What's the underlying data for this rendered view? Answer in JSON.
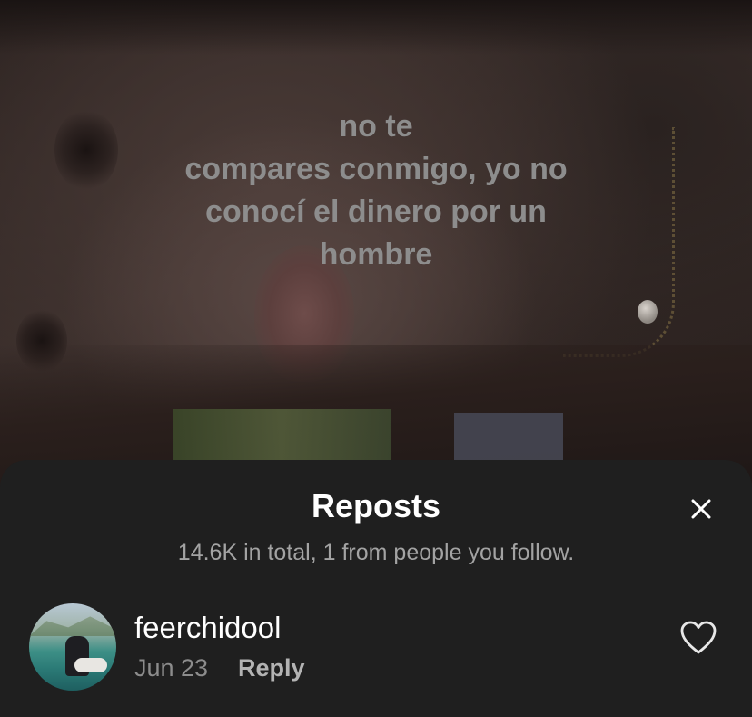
{
  "post": {
    "overlay_text": "no te\ncompares conmigo, yo no\nconocí el dinero por un\nhombre"
  },
  "sheet": {
    "title": "Reposts",
    "close_icon": "close-icon",
    "subtitle": "14.6K in total, 1 from people you follow."
  },
  "reposts": [
    {
      "username": "feerchidool",
      "date": "Jun 23",
      "reply_label": "Reply",
      "like_icon": "heart-outline-icon"
    }
  ],
  "colors": {
    "sheet_background": "#1f1f1f",
    "primary_text": "#ffffff",
    "secondary_text": "#a3a3a3",
    "overlay_text": "#8d8d8d"
  }
}
